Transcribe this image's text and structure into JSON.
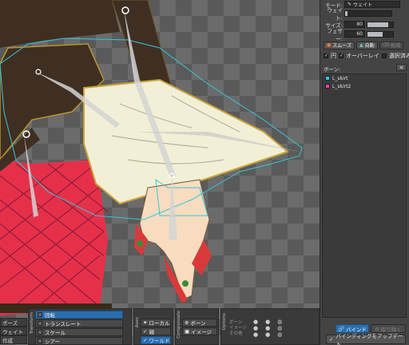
{
  "panel": {
    "mode_label": "モード:",
    "mode_value": "ウェイト",
    "weight_label": "ウェイト:",
    "weight_level": 0.05,
    "size_label": "サイズ:",
    "size_value": "80",
    "size_level": 0.8,
    "feather_label": "フェザー:",
    "feather_value": "60",
    "feather_level": 0.6,
    "smooth_label": "スムーズ",
    "auto_label": "自動",
    "remove_label": "削減",
    "circle_label": "円",
    "overlay_label": "オーバーレイ",
    "selected_only_label": "選択済み",
    "bones_title": "ボーン:",
    "bones": [
      {
        "name": "L_skirt",
        "color": "#35c8e6"
      },
      {
        "name": "L_skirt2",
        "color": "#e040a8"
      }
    ],
    "bind_label": "バインド",
    "unbind_label": "取り除く",
    "update_binding_label": "バインディングをアップデート"
  },
  "toolbar": {
    "left_items": [
      "ポーズ",
      "ウェイト",
      "作成"
    ],
    "transform_title": "Transform",
    "transform_items": [
      {
        "label": "回転",
        "selected": true
      },
      {
        "label": "トランスレート",
        "selected": false
      },
      {
        "label": "スケール",
        "selected": false
      },
      {
        "label": "シアー",
        "selected": false
      }
    ],
    "axes_title": "Axes",
    "axes_items": [
      {
        "label": "ローカル",
        "selected": false
      },
      {
        "label": "親",
        "selected": false
      },
      {
        "label": "ワールド",
        "selected": true
      }
    ],
    "compensate_title": "Compensate",
    "compensate_items": [
      {
        "label": "ボーン",
        "selected": false
      },
      {
        "label": "イメージ",
        "selected": false
      }
    ],
    "options_title": "Options",
    "option_rows": [
      "ボーン",
      "イメージ",
      "その他"
    ]
  },
  "colors": {
    "accent": "#2a6fb0",
    "mesh_outline": "#37c4d8",
    "annotation_arrow": "#ff3fa8"
  }
}
